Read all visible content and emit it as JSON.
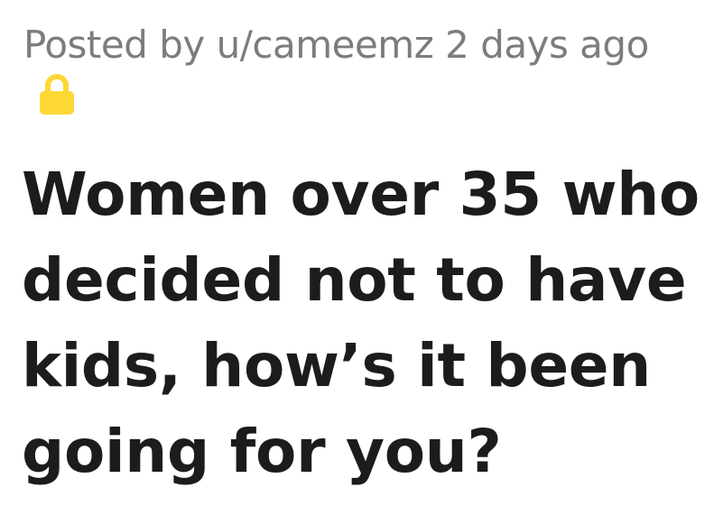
{
  "post": {
    "meta": {
      "prefix": "Posted by",
      "author": "u/cameemz",
      "age": "2 days ago"
    },
    "lock_icon": "lock-icon",
    "lock_color": "#fdd835",
    "title_lines": [
      "Women over 35 who",
      "decided not to have",
      "kids, how’s it been",
      "going for you?"
    ]
  }
}
